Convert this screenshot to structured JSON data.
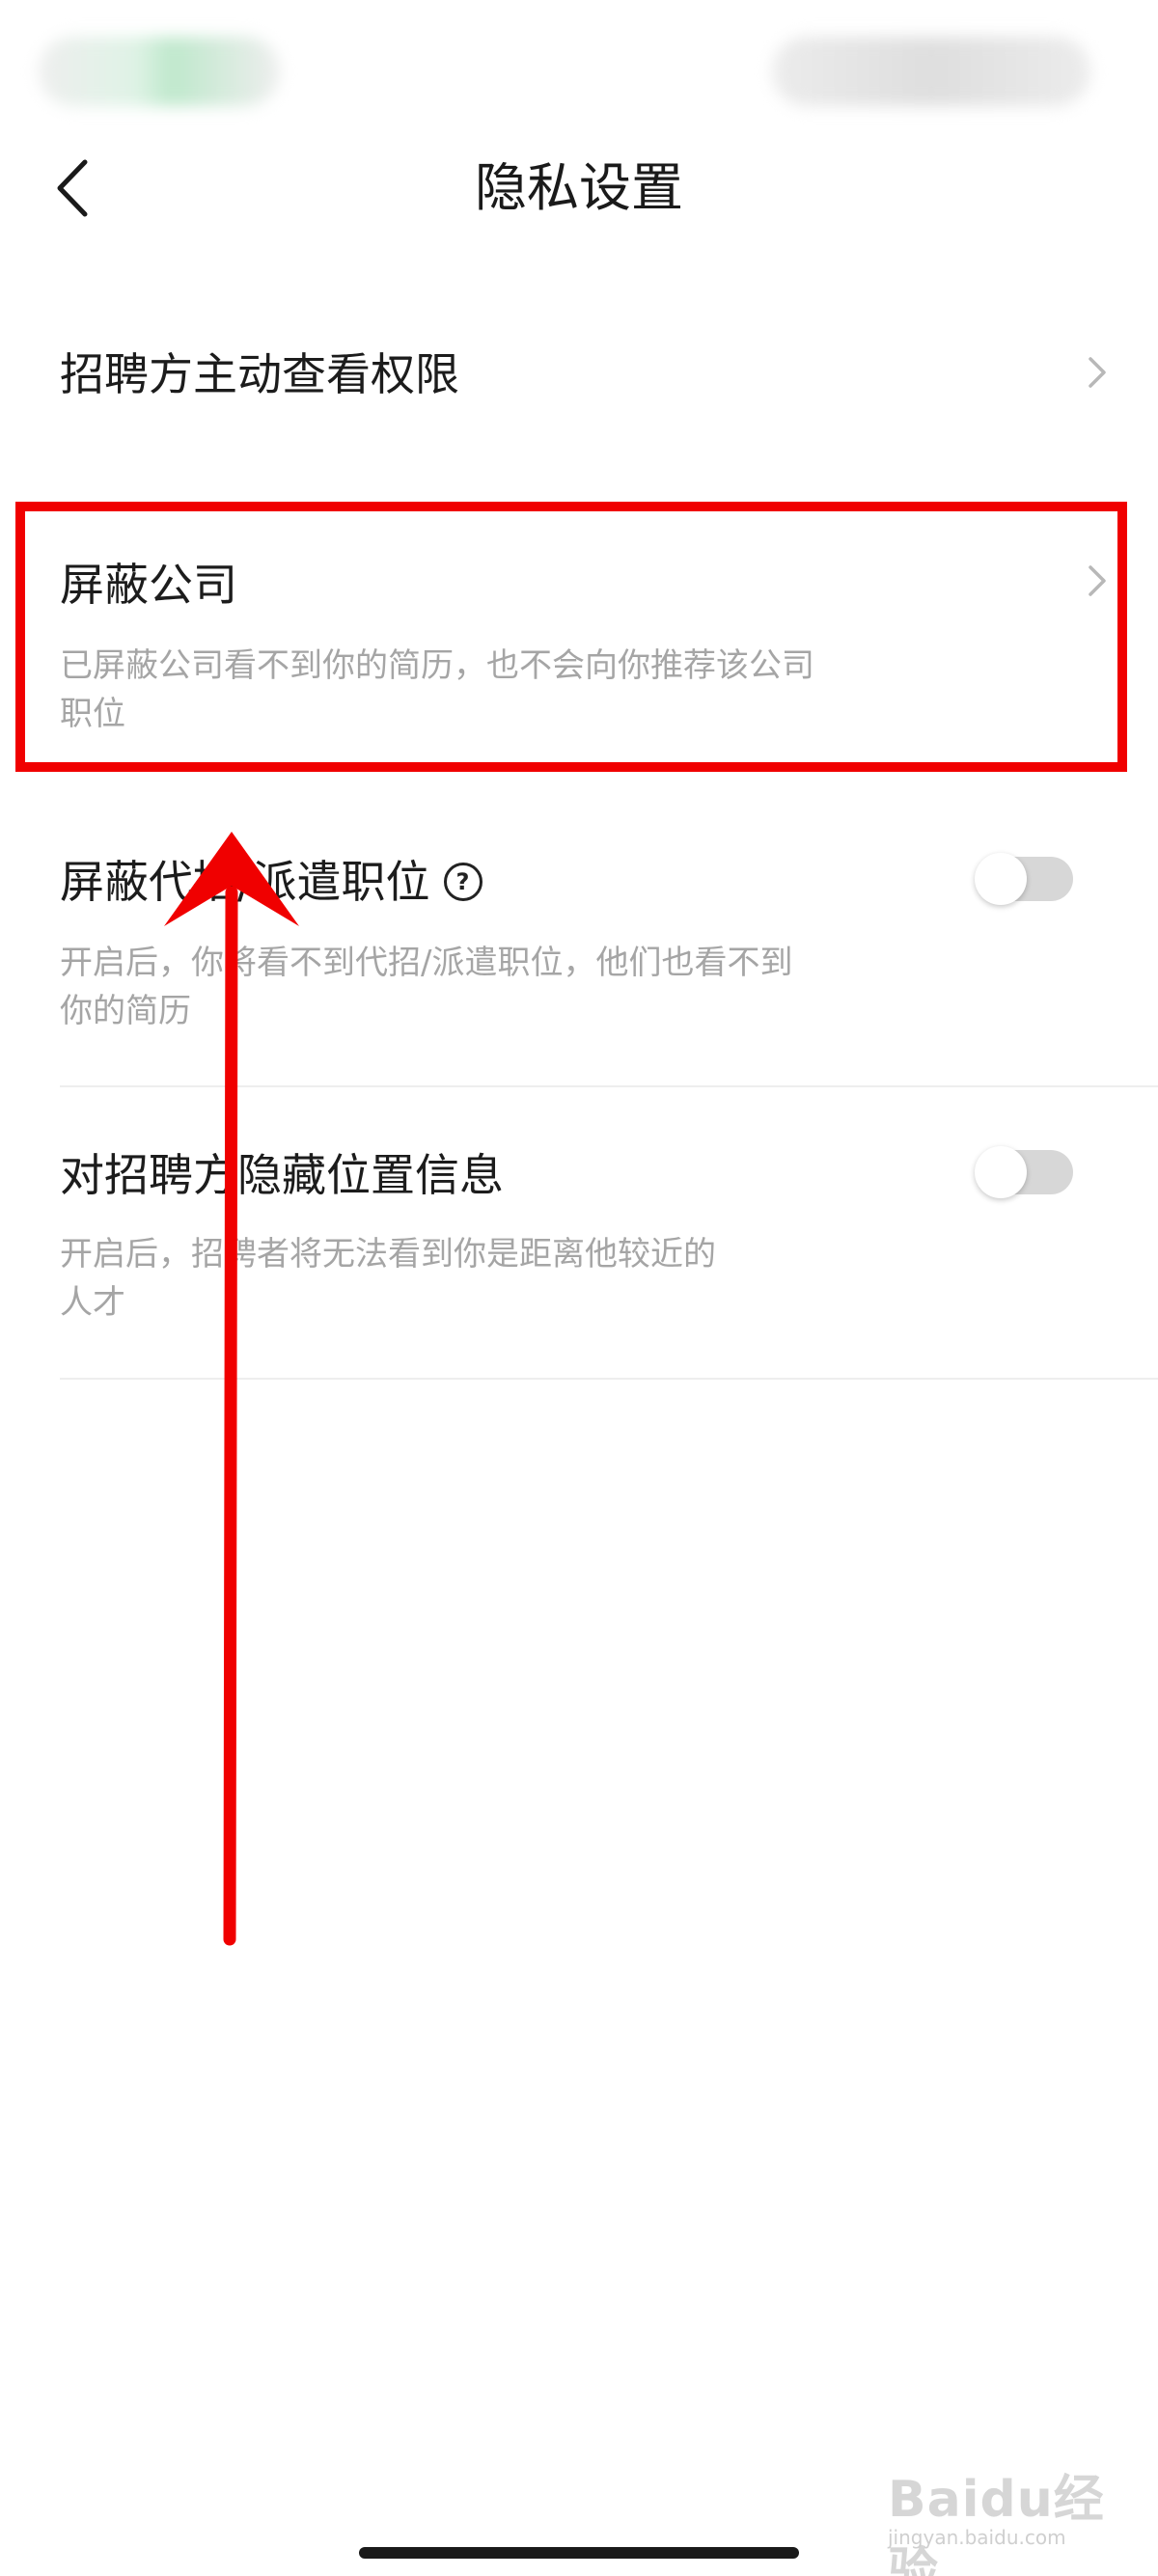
{
  "header": {
    "title": "隐私设置",
    "back_icon": "chevron-left-icon"
  },
  "settings": [
    {
      "title": "招聘方主动查看权限",
      "control": "chevron"
    },
    {
      "title": "屏蔽公司",
      "description_line1": "已屏蔽公司看不到你的简历，也不会向你推荐该公司",
      "description_line2": "职位",
      "control": "chevron",
      "highlighted": true
    },
    {
      "title": "屏蔽代招/派遣职位",
      "description_line1": "开启后，你将看不到代招/派遣职位，他们也看不到",
      "description_line2": "你的简历",
      "control": "toggle",
      "enabled": false,
      "help_icon": "question-circle-icon",
      "help_glyph": "?"
    },
    {
      "title": "对招聘方隐藏位置信息",
      "description_line1": "开启后，招聘者将无法看到你是距离他较近的",
      "description_line2": "人才",
      "control": "toggle",
      "enabled": false
    }
  ],
  "annotation": {
    "highlight_color": "#f00000",
    "arrow_color": "#f00000"
  },
  "watermark": {
    "brand": "Baidu经验",
    "url": "jingyan.baidu.com"
  }
}
